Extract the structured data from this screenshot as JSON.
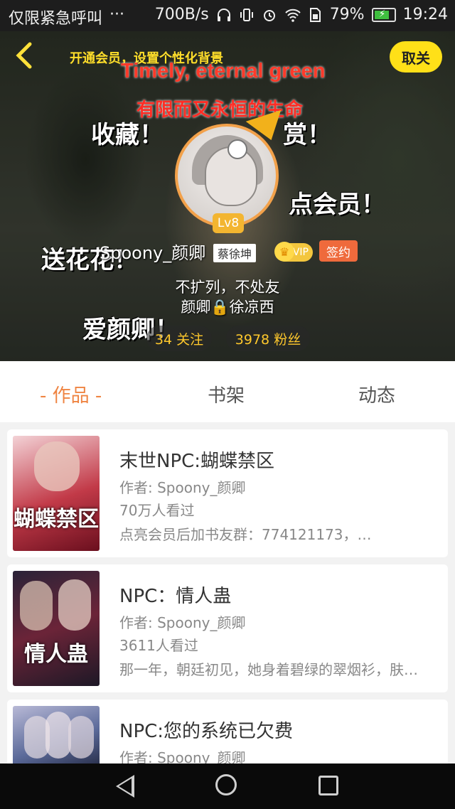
{
  "status_bar": {
    "carrier": "仅限紧急呼叫",
    "more": "···",
    "speed": "700B/s",
    "battery": "79%",
    "time": "19:24",
    "battery_level": 0.79
  },
  "header": {
    "vip_tip": "开通会员，设置个性化背景",
    "unfollow_label": "取关",
    "motto_en": "Timely, eternal green",
    "motto_cn": "有限而又永恒的生命",
    "overlay_words": [
      "收藏！",
      "赏！",
      "点会员！",
      "送花花！",
      "爱颜卿！"
    ]
  },
  "profile": {
    "level": "Lv8",
    "username": "Spoony_颜卿",
    "tag": "蔡徐坤",
    "vip_label": "VIP",
    "signed_label": "签约",
    "bio_line1": "不扩列，不处友",
    "bio_line2": "颜卿🔒徐凉西",
    "following": "34 关注",
    "followers": "3978 粉丝"
  },
  "tabs": [
    {
      "label": "- 作品 -",
      "active": true
    },
    {
      "label": "书架",
      "active": false
    },
    {
      "label": "动态",
      "active": false
    }
  ],
  "books": [
    {
      "title": "末世NPC:蝴蝶禁区",
      "author": "作者: Spoony_颜卿",
      "views": "70万人看过",
      "desc": "点亮会员后加书友群：774121173，…",
      "cover_text": "蝴蝶禁区"
    },
    {
      "title": "NPC：情人蛊",
      "author": "作者: Spoony_颜卿",
      "views": "3611人看过",
      "desc": "那一年，朝廷初见，她身着碧绿的翠烟衫，肤…",
      "cover_text": "情人蛊"
    },
    {
      "title": "NPC:您的系统已欠费",
      "author": "作者: Spoony_颜卿",
      "views": "",
      "desc": "",
      "cover_text": ""
    }
  ],
  "colors": {
    "accent": "#ef8442",
    "yellow": "#ffe018",
    "vip": "#f3c63e",
    "signed": "#ef6a3c"
  }
}
